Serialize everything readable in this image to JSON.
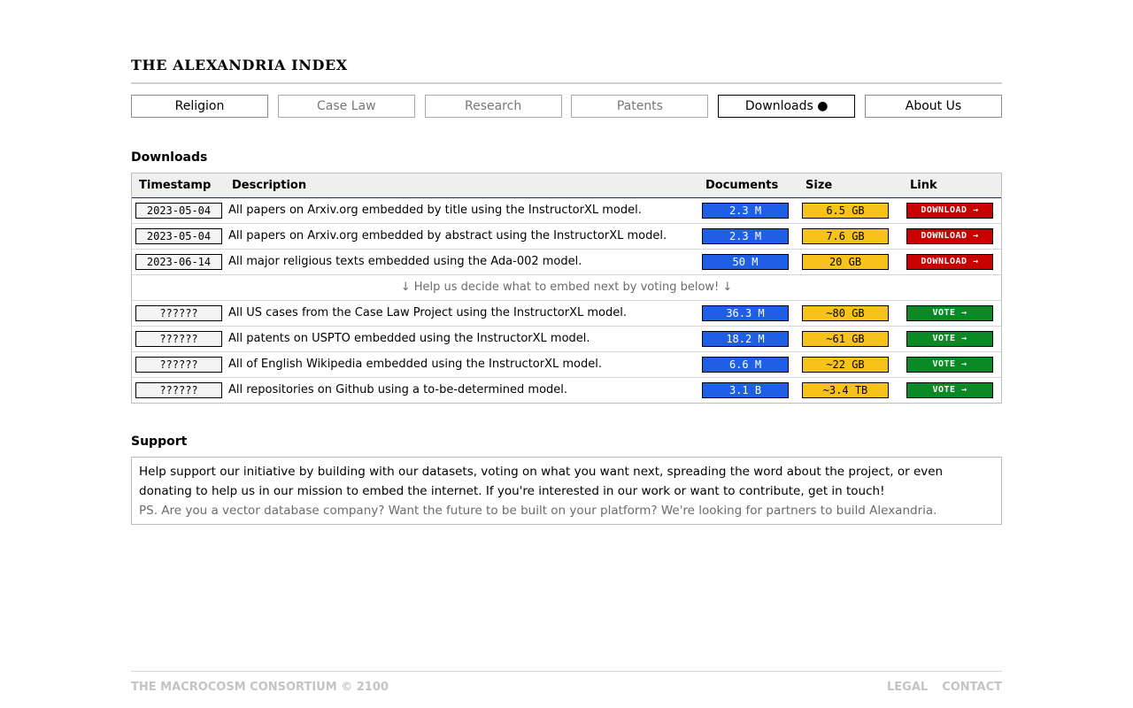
{
  "site": {
    "title": "THE ALEXANDRIA INDEX"
  },
  "nav": {
    "tabs": [
      {
        "label": "Religion",
        "state": "normal"
      },
      {
        "label": "Case Law",
        "state": "disabled"
      },
      {
        "label": "Research",
        "state": "disabled"
      },
      {
        "label": "Patents",
        "state": "disabled"
      },
      {
        "label": "Downloads ●",
        "state": "active"
      },
      {
        "label": "About Us",
        "state": "normal"
      }
    ]
  },
  "downloads": {
    "heading": "Downloads",
    "columns": [
      "Timestamp",
      "Description",
      "Documents",
      "Size",
      "Link"
    ],
    "rows": [
      {
        "timestamp": "2023-05-04",
        "description": "All papers on Arxiv.org embedded by title using the InstructorXL model.",
        "documents": "2.3 M",
        "size": "6.5 GB",
        "link": "DOWNLOAD →"
      },
      {
        "timestamp": "2023-05-04",
        "description": "All papers on Arxiv.org embedded by abstract using the InstructorXL model.",
        "documents": "2.3 M",
        "size": "7.6 GB",
        "link": "DOWNLOAD →"
      },
      {
        "timestamp": "2023-06-14",
        "description": "All major religious texts embedded using the Ada-002 model.",
        "documents": "50 M",
        "size": "20 GB",
        "link": "DOWNLOAD →"
      }
    ],
    "vote_banner": "↓  Help us decide what to embed next by voting below!  ↓",
    "vote_rows": [
      {
        "timestamp": "??????",
        "description": "All US cases from the Case Law Project using the InstructorXL model.",
        "documents": "36.3 M",
        "size": "~80 GB",
        "link": "VOTE →"
      },
      {
        "timestamp": "??????",
        "description": "All patents on USPTO embedded using the InstructorXL model.",
        "documents": "18.2 M",
        "size": "~61 GB",
        "link": "VOTE →"
      },
      {
        "timestamp": "??????",
        "description": "All of English Wikipedia embedded using the InstructorXL model.",
        "documents": "6.6 M",
        "size": "~22 GB",
        "link": "VOTE →"
      },
      {
        "timestamp": "??????",
        "description": "All repositories on Github using a to-be-determined model.",
        "documents": "3.1 B",
        "size": "~3.4 TB",
        "link": "VOTE →"
      }
    ]
  },
  "support": {
    "heading": "Support",
    "body": "Help support our initiative by building with our datasets, voting on what you want next, spreading the word about the project, or even donating to help us in our mission to embed the internet. If you're interested in our work or want to contribute, get in touch!",
    "ps": "PS. Are you a vector database company? Want the future to be built on your platform? We're looking for partners to build Alexandria."
  },
  "footer": {
    "copyright": "THE MACROCOSM CONSORTIUM © 2100",
    "legal": "LEGAL",
    "contact": "CONTACT"
  },
  "colors": {
    "documents_bg": "#1f5fe6",
    "size_bg": "#f7c31a",
    "download_bg": "#c80000",
    "vote_bg": "#098a24"
  }
}
